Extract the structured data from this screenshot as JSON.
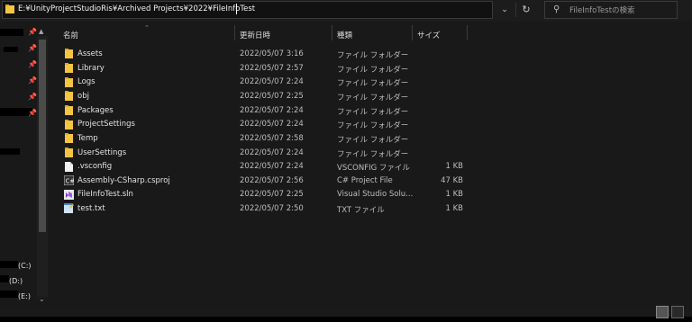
{
  "address_bar": {
    "path": "E:¥UnityProjectStudioRis¥Archived Projects¥2022¥FileInfoTest"
  },
  "search": {
    "placeholder": "FileInfoTestの検索"
  },
  "nav": {
    "drives": [
      "(C:)",
      "(D:)",
      "(E:)"
    ]
  },
  "columns": {
    "name": "名前",
    "date": "更新日時",
    "type": "種類",
    "size": "サイズ"
  },
  "files": [
    {
      "name": "Assets",
      "date": "2022/05/07 3:16",
      "type": "ファイル フォルダー",
      "size": "",
      "icon": "folder-icon"
    },
    {
      "name": "Library",
      "date": "2022/05/07 2:57",
      "type": "ファイル フォルダー",
      "size": "",
      "icon": "folder-icon"
    },
    {
      "name": "Logs",
      "date": "2022/05/07 2:24",
      "type": "ファイル フォルダー",
      "size": "",
      "icon": "folder-icon"
    },
    {
      "name": "obj",
      "date": "2022/05/07 2:25",
      "type": "ファイル フォルダー",
      "size": "",
      "icon": "folder-icon"
    },
    {
      "name": "Packages",
      "date": "2022/05/07 2:24",
      "type": "ファイル フォルダー",
      "size": "",
      "icon": "folder-icon"
    },
    {
      "name": "ProjectSettings",
      "date": "2022/05/07 2:24",
      "type": "ファイル フォルダー",
      "size": "",
      "icon": "folder-icon"
    },
    {
      "name": "Temp",
      "date": "2022/05/07 2:58",
      "type": "ファイル フォルダー",
      "size": "",
      "icon": "folder-icon"
    },
    {
      "name": "UserSettings",
      "date": "2022/05/07 2:24",
      "type": "ファイル フォルダー",
      "size": "",
      "icon": "folder-icon"
    },
    {
      "name": ".vsconfig",
      "date": "2022/05/07 2:24",
      "type": "VSCONFIG ファイル",
      "size": "1 KB",
      "icon": "document-icon"
    },
    {
      "name": "Assembly-CSharp.csproj",
      "date": "2022/05/07 2:56",
      "type": "C# Project File",
      "size": "47 KB",
      "icon": "csproj-icon"
    },
    {
      "name": "FileInfoTest.sln",
      "date": "2022/05/07 2:25",
      "type": "Visual Studio Solu...",
      "size": "1 KB",
      "icon": "visual-studio-solution-icon"
    },
    {
      "name": "test.txt",
      "date": "2022/05/07 2:50",
      "type": "TXT ファイル",
      "size": "1 KB",
      "icon": "notepad-icon"
    }
  ],
  "colors": {
    "folder": "#f4c543",
    "background": "#191919",
    "text": "#e6e6e6"
  }
}
